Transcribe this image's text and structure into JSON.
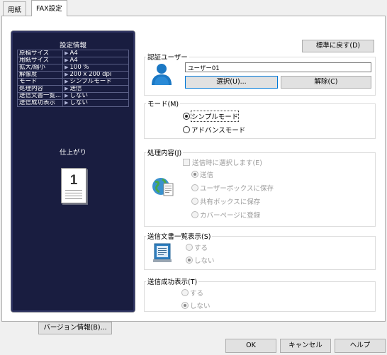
{
  "tabs": [
    {
      "label": "用紙",
      "active": false
    },
    {
      "label": "FAX設定",
      "active": true
    }
  ],
  "settings_panel": {
    "title": "設定情報",
    "rows": [
      {
        "key": "原稿サイズ",
        "value": "A4"
      },
      {
        "key": "用紙サイズ",
        "value": "A4"
      },
      {
        "key": "拡大/縮小",
        "value": "100 %"
      },
      {
        "key": "解像度",
        "value": "200 x 200 dpi"
      },
      {
        "key": "モード",
        "value": "シンプルモード"
      },
      {
        "key": "処理内容",
        "value": "送信"
      },
      {
        "key": "送信文書一覧...",
        "value": "しない"
      },
      {
        "key": "送信成功表示",
        "value": "しない"
      }
    ],
    "finish_label": "仕上がり",
    "page_number": "1"
  },
  "version_button": "バージョン情報(B)...",
  "restore_default_button": "標準に戻す(D)",
  "auth_user": {
    "title": "認証ユーザー",
    "user_name": "ユーザー01",
    "select_button": "選択(U)...",
    "clear_button": "解除(C)"
  },
  "mode": {
    "title": "モード(M)",
    "options": [
      {
        "label": "シンプルモード",
        "checked": true
      },
      {
        "label": "アドバンスモード",
        "checked": false
      }
    ]
  },
  "processing": {
    "title": "処理内容(J)",
    "checkbox_label": "送信時に選択します(E)",
    "options": [
      {
        "label": "送信",
        "checked": true
      },
      {
        "label": "ユーザーボックスに保存",
        "checked": false
      },
      {
        "label": "共有ボックスに保存",
        "checked": false
      },
      {
        "label": "カバーページに登録",
        "checked": false
      }
    ]
  },
  "sent_list": {
    "title": "送信文書一覧表示(S)",
    "options": [
      {
        "label": "する",
        "checked": false
      },
      {
        "label": "しない",
        "checked": true
      }
    ]
  },
  "success_display": {
    "title": "送信成功表示(T)",
    "options": [
      {
        "label": "する",
        "checked": false
      },
      {
        "label": "しない",
        "checked": true
      }
    ]
  },
  "dialog_buttons": {
    "ok": "OK",
    "cancel": "キャンセル",
    "help": "ヘルプ"
  },
  "colors": {
    "panel_bg": "#191d40",
    "accent": "#0078d7"
  }
}
